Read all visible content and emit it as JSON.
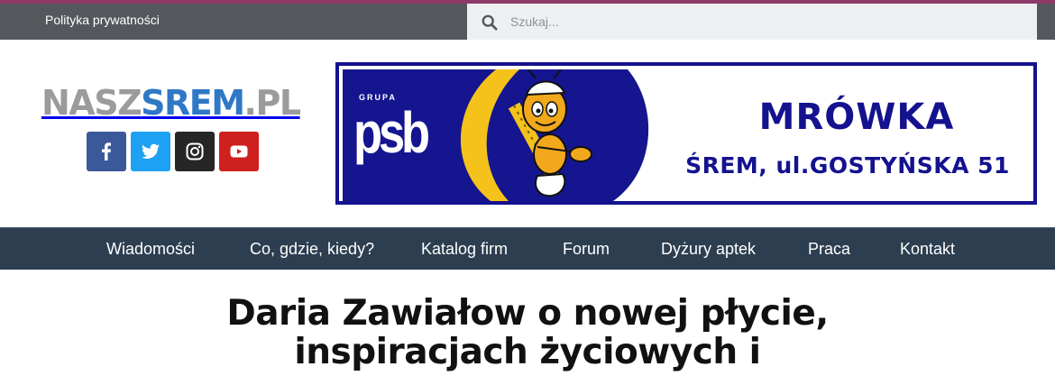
{
  "accent_color": "#8e3a68",
  "topbar": {
    "privacy_link": "Polityka prywatności",
    "search_placeholder": "Szukaj..."
  },
  "logo": {
    "part1": "NASZ",
    "part2": "SREM",
    "part3": ".PL"
  },
  "socials": [
    {
      "name": "facebook",
      "icon": "facebook-icon",
      "color": "#3b5998"
    },
    {
      "name": "twitter",
      "icon": "twitter-icon",
      "color": "#1da1f2"
    },
    {
      "name": "instagram",
      "icon": "instagram-icon",
      "color": "#262626"
    },
    {
      "name": "youtube",
      "icon": "youtube-icon",
      "color": "#cd201f"
    }
  ],
  "banner": {
    "grupa": "GRUPA",
    "brand": "psb",
    "title": "MRÓWKA",
    "address": "ŚREM, ul.GOSTYŃSKA 51",
    "color": "#14128f"
  },
  "nav": {
    "items": [
      "Wiadomości",
      "Co, gdzie, kiedy?",
      "Katalog firm",
      "Forum",
      "Dyżury aptek",
      "Praca",
      "Kontakt"
    ]
  },
  "article": {
    "title_line1": "Daria Zawiałow o nowej płycie,",
    "title_line2": "inspiracjach życiowych i"
  }
}
